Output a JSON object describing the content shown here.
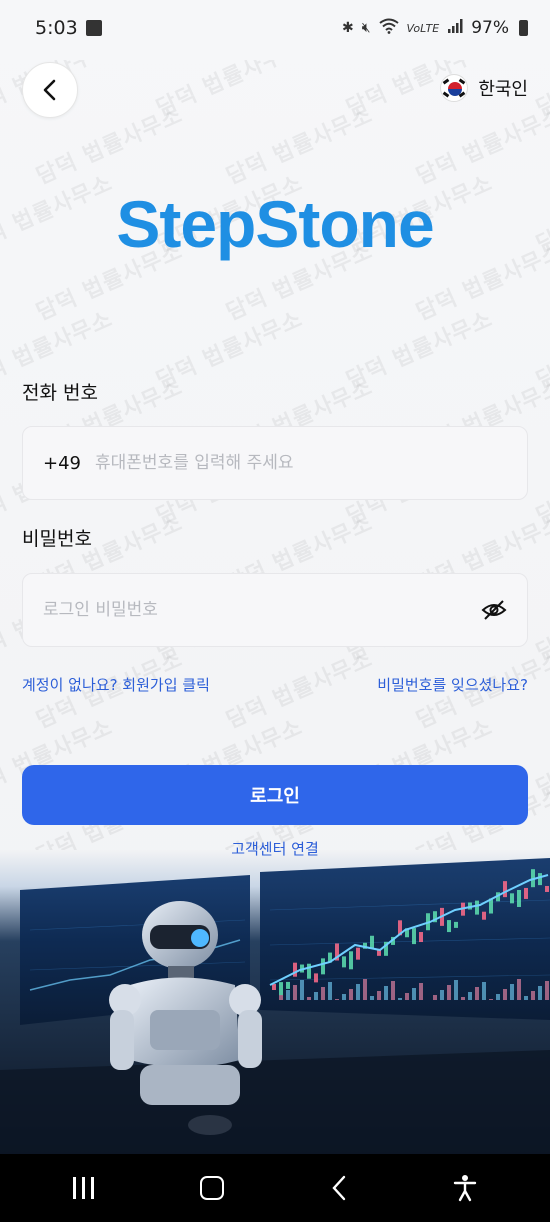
{
  "status_bar": {
    "time": "5:03",
    "battery": "97%"
  },
  "header": {
    "language_label": "한국인"
  },
  "brand": {
    "name": "StepStone"
  },
  "watermark_text": "담덕 법률사무소",
  "phone": {
    "label": "전화 번호",
    "country_code": "+49",
    "placeholder": "휴대폰번호를 입력해 주세요"
  },
  "password": {
    "label": "비밀번호",
    "placeholder": "로그인 비밀번호"
  },
  "links": {
    "signup": "계정이 없나요? 회원가입 클릭",
    "forgot": "비밀번호를 잊으셨나요?"
  },
  "login_button": "로그인",
  "support_link": "고객센터 연결",
  "colors": {
    "brand": "#1f8fe3",
    "primary": "#2f66ea",
    "link": "#2d5fd8"
  }
}
